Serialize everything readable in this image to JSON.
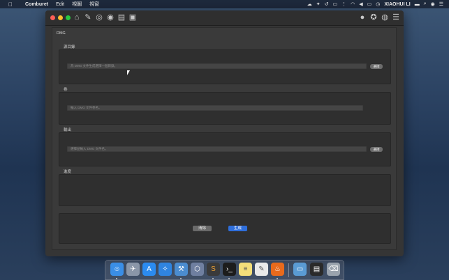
{
  "menubar": {
    "app_name": "Comburet",
    "items": [
      "Edit",
      "視圖",
      "視窗"
    ],
    "user": "XIAOHUI LI"
  },
  "window": {
    "section_title": "DMG",
    "source": {
      "label": "源目錄",
      "placeholder": "為 DMG 文件生成選擇一個目錄。",
      "pick_label": "選擇"
    },
    "volume": {
      "label": "卷",
      "placeholder": "輸入 DMG 文件卷名。"
    },
    "output": {
      "label": "輸出",
      "placeholder": "選擇並輸入 DMG 文件名。",
      "pick_label": "選擇"
    },
    "progress": {
      "label": "進度"
    },
    "actions": {
      "clear_label": "清除",
      "generate_label": "生成"
    }
  },
  "icons": {
    "toolbar": [
      "home-icon",
      "notes-icon",
      "disk-icon",
      "disc-icon",
      "document-icon",
      "clipboard-icon",
      "user-icon",
      "safari-icon",
      "globe-icon",
      "storage-icon"
    ],
    "dock": [
      "finder-icon",
      "launchpad-icon",
      "app-store-icon",
      "safari-icon",
      "xcode-icon",
      "cube-icon",
      "sublime-icon",
      "terminal-icon",
      "notes-icon",
      "pages-icon",
      "firefox-icon",
      "folder-icon",
      "screenshot-icon",
      "trash-icon"
    ]
  },
  "colors": {
    "accent": "#2f6fdc",
    "close": "#fe5f57",
    "minimize": "#febc2e",
    "maximize": "#28c840"
  }
}
